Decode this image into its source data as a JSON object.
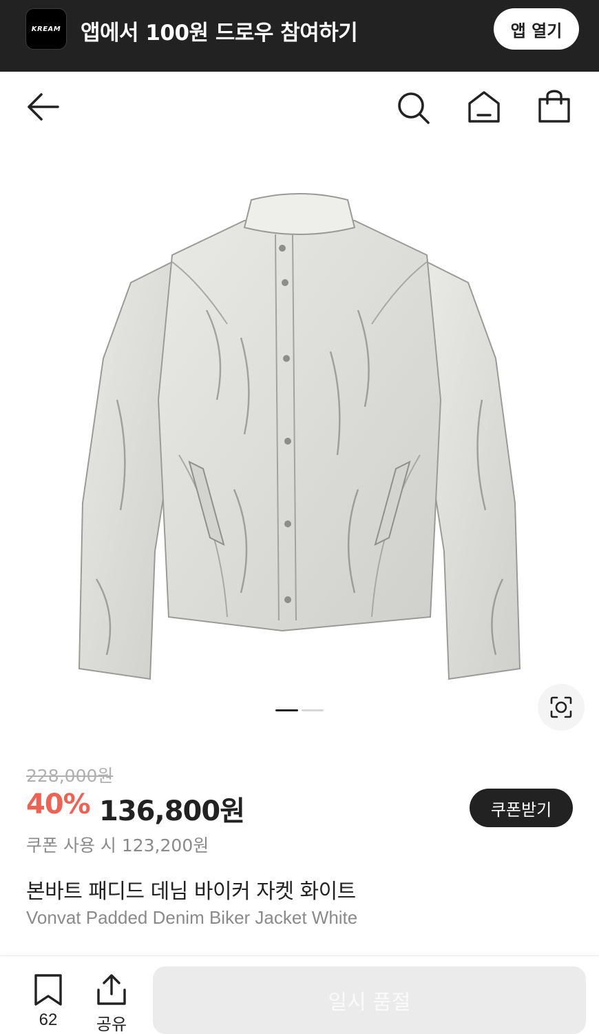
{
  "app_banner": {
    "logo_text": "KREAM",
    "message": "앱에서 100원 드로우 참여하기",
    "open_button": "앱 열기"
  },
  "header": {
    "icons": [
      "back-arrow-icon",
      "search-icon",
      "home-icon",
      "shopping-bag-icon"
    ]
  },
  "gallery": {
    "image": "white-grey distressed denim biker jacket",
    "pages_total": 2,
    "current_page": 1,
    "lens_icon": "image-search-lens-icon"
  },
  "pricing": {
    "original_price": "228,000원",
    "discount_rate": "40%",
    "sale_price": "136,800원",
    "coupon_button": "쿠폰받기",
    "coupon_price": "쿠폰 사용 시 123,200원"
  },
  "product": {
    "title_ko": "본바트 패디드 데님 바이커 자켓 화이트",
    "title_en": "Vonvat Padded Denim Biker Jacket White"
  },
  "bottom_bar": {
    "wish_count": "62",
    "share_label": "공유",
    "soldout_label": "일시 품절"
  },
  "colors": {
    "banner_bg": "#222222",
    "discount": "#ef6253",
    "button_dark": "#222222",
    "soldout_bg": "#ebebeb"
  }
}
